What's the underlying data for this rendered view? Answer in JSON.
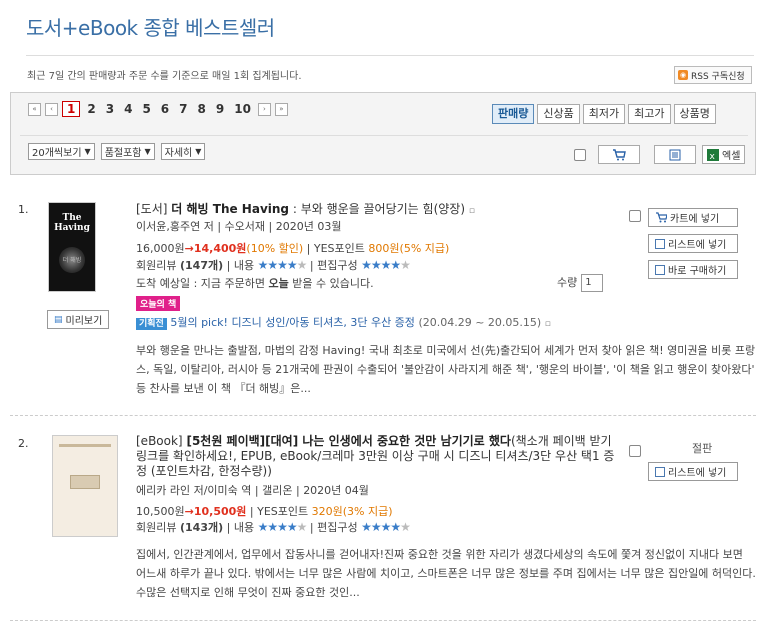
{
  "page": {
    "title": "도서+eBook 종합 베스트셀러",
    "subtitle": "최근 7일 간의 판매량과 주문 수를 기준으로 매일 1회 집계됩니다.",
    "rss_label": "RSS 구독신청"
  },
  "pager": {
    "first": "«",
    "prev": "‹",
    "next": "›",
    "last": "»",
    "pages": [
      "1",
      "2",
      "3",
      "4",
      "5",
      "6",
      "7",
      "8",
      "9",
      "10"
    ],
    "current": "1"
  },
  "sort_tabs": [
    "판매량",
    "신상품",
    "최저가",
    "최고가",
    "상품명"
  ],
  "filters": {
    "per_page": "20개씩보기",
    "stock": "품절포함",
    "view": "자세히"
  },
  "toolbar": {
    "excel_label": "엑셀"
  },
  "items": [
    {
      "rank": "1.",
      "category": "[도서]",
      "title": "더 해빙 The Having",
      "subtitle": " : 부와 행운을 끌어당기는 힘(양장)",
      "authors": "이서윤,홍주연 저",
      "publisher": "수오서재",
      "date": "2020년 03월",
      "list_price": "16,000원",
      "arrow": "→",
      "sale_price": "14,400원",
      "discount": "(10% 할인)",
      "points_label": "YES포인트",
      "points": "800원",
      "points_rate": "(5% 지급)",
      "review_label": "회원리뷰",
      "review_count": "(147개)",
      "content_label": "내용",
      "edit_label": "편집구성",
      "delivery": "도착 예상일 : 지금 주문하면",
      "delivery_bold": "오늘",
      "delivery_tail": "받을 수 있습니다.",
      "today_badge": "오늘의 책",
      "event_badge": "기획전",
      "event_text": "5월의 pick! 디즈니 성인/아동 티셔츠, 3단 우산 증정",
      "event_period": "(20.04.29 ~ 20.05.15)",
      "description": "부와 행운을 만나는 출발점, 마법의 감정 Having! 국내 최초로 미국에서 선(先)출간되어 세계가 먼저 찾아 읽은 책! 영미권을 비롯 프랑스, 독일, 이탈리아, 러시아 등 21개국에 판권이 수출되어 '불안감이 사라지게 해준 책', '행운의 바이블', '이 책을 읽고 행운이 찾아왔다' 등 찬사를 보낸 이 책 『더 해빙』은...",
      "preview_label": "미리보기",
      "qty_label": "수량",
      "qty_value": "1",
      "cart_label": "카트에 넣기",
      "list_label": "리스트에 넣기",
      "buy_label": "바로 구매하기",
      "cover_text": "The Having",
      "cover_small": "더 해빙"
    },
    {
      "rank": "2.",
      "category": "[eBook]",
      "title": "[5천원 페이백][대여] 나는 인생에서 중요한 것만 남기기로 했다",
      "title_tail": "(책소개 페이백 받기 링크를 확인하세요!, EPUB, eBook/크레마 3만원 이상 구매 시 디즈니 티셔츠/3단 우산 택1 증정 (포인트차감, 한정수량))",
      "authors": "에리카 라인 저/이미숙 역",
      "publisher": "갤리온",
      "date": "2020년 04월",
      "list_price": "10,500원",
      "arrow": "→",
      "sale_price": "10,500원",
      "points_label": "YES포인트",
      "points": "320원",
      "points_rate": "(3% 지급)",
      "review_label": "회원리뷰",
      "review_count": "(143개)",
      "content_label": "내용",
      "edit_label": "편집구성",
      "description": "집에서, 인간관계에서, 업무에서 잡동사니를 걷어내자!진짜 중요한 것을 위한 자리가 생겼다세상의 속도에 쫓겨 정신없이 지내다 보면 어느새 하루가 끝나 있다. 밖에서는 너무 많은 사람에 치이고, 스마트폰은 너무 많은 정보를 주며 집에서는 너무 많은 집안일에 허덕인다. 수많은 선택지로 인해 무엇이 진짜 중요한 것인...",
      "status": "절판",
      "list_label": "리스트에 넣기"
    }
  ],
  "colors": {
    "title": "#3a6fa6",
    "price_red": "#e0301e",
    "points_orange": "#e07800",
    "star_blue": "#3a7dc8",
    "today_pink": "#e0208a"
  }
}
